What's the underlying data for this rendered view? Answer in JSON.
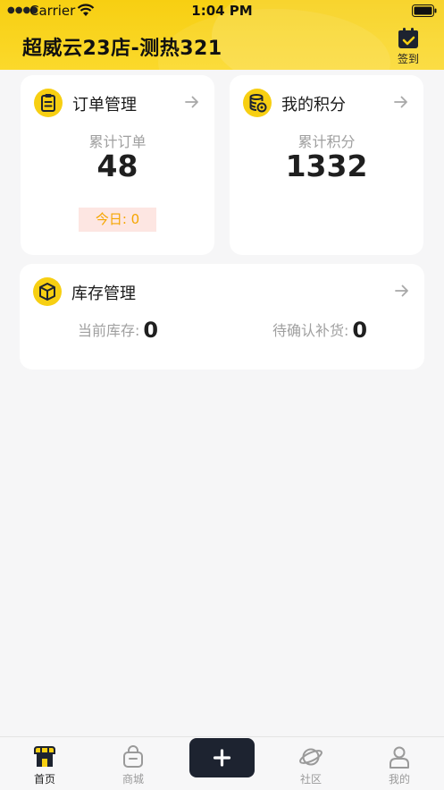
{
  "status_bar": {
    "carrier": "Carrier",
    "time": "1:04 PM"
  },
  "header": {
    "title": "超威云23店-测热321",
    "checkin_label": "签到",
    "background_color": "#f7cf12"
  },
  "orders_card": {
    "title": "订单管理",
    "icon": "clipboard-icon",
    "metric_label": "累计订单",
    "metric_value": "48",
    "today_label": "今日: 0"
  },
  "points_card": {
    "title": "我的积分",
    "icon": "coin-stack-icon",
    "metric_label": "累计积分",
    "metric_value": "1332"
  },
  "stock_card": {
    "title": "库存管理",
    "icon": "box-icon",
    "current_label": "当前库存:",
    "current_value": "0",
    "pending_label": "待确认补货:",
    "pending_value": "0"
  },
  "tabbar": {
    "tabs": [
      {
        "label": "首页",
        "icon": "store-icon",
        "active": true
      },
      {
        "label": "商城",
        "icon": "bag-icon",
        "active": false
      },
      {
        "label": "社区",
        "icon": "planet-icon",
        "active": false
      },
      {
        "label": "我的",
        "icon": "person-icon",
        "active": false
      }
    ],
    "plus_icon": "plus-icon"
  }
}
